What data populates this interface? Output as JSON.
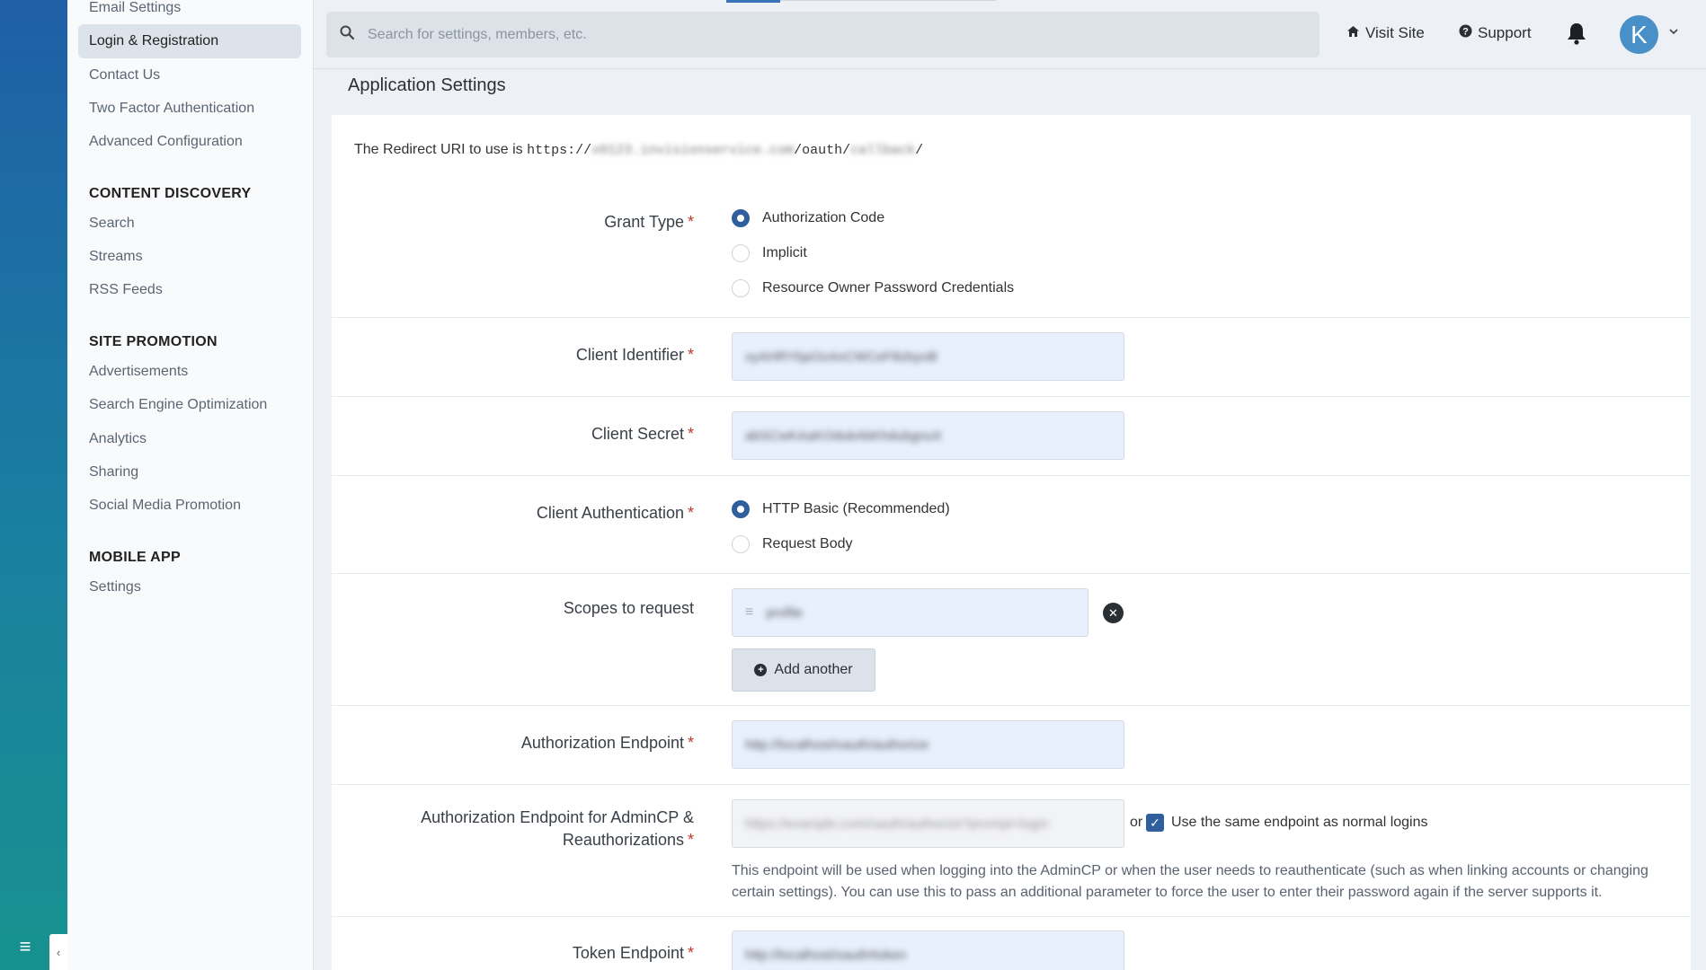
{
  "strip": {
    "menu_glyph": "≡",
    "collapse_glyph": "‹"
  },
  "sidebar": {
    "items": [
      {
        "label": "Email Settings"
      },
      {
        "label": "Login & Registration"
      },
      {
        "label": "Contact Us"
      },
      {
        "label": "Two Factor Authentication"
      },
      {
        "label": "Advanced Configuration"
      }
    ],
    "groups": [
      {
        "heading": "CONTENT DISCOVERY",
        "items": [
          "Search",
          "Streams",
          "RSS Feeds"
        ]
      },
      {
        "heading": "SITE PROMOTION",
        "items": [
          "Advertisements",
          "Search Engine Optimization",
          "Analytics",
          "Sharing",
          "Social Media Promotion"
        ]
      },
      {
        "heading": "MOBILE APP",
        "items": [
          "Settings"
        ]
      }
    ],
    "active_item": "Login & Registration"
  },
  "header": {
    "search_placeholder": "Search for settings, members, etc.",
    "visit_site": "Visit Site",
    "support": "Support",
    "avatar_letter": "K"
  },
  "page": {
    "section_title": "Application Settings",
    "redirect_prefix": "The Redirect URI to use is ",
    "redirect_scheme": "https://",
    "redirect_host": "x0123.invisionservice.com",
    "redirect_path": "/oauth/",
    "redirect_key": "callback",
    "redirect_end": "/",
    "grant_type": {
      "label": "Grant Type",
      "options": [
        "Authorization Code",
        "Implicit",
        "Resource Owner Password Credentials"
      ],
      "selected": 0
    },
    "client_identifier": {
      "label": "Client Identifier",
      "value": "xyAHRYbpOzAnCWCeF8zbyoB"
    },
    "client_secret": {
      "label": "Client Secret",
      "value": "abSCwKAaKOdukAbKhdubgnuX"
    },
    "client_auth": {
      "label": "Client Authentication",
      "options": [
        "HTTP Basic (Recommended)",
        "Request Body"
      ],
      "selected": 0
    },
    "scopes": {
      "label": "Scopes to request",
      "value": "profile",
      "add_label": "Add another"
    },
    "auth_endpoint": {
      "label": "Authorization Endpoint",
      "value": "http://localhost/oauth/authorize"
    },
    "auth_endpoint_admin": {
      "label_line1": "Authorization Endpoint for AdminCP &",
      "label_line2": "Reauthorizations",
      "value": "https://example.com/oauth/authorize?prompt=login",
      "or": "or",
      "checkbox_label": "Use the same endpoint as normal logins",
      "checked": true,
      "help": "This endpoint will be used when logging into the AdminCP or when the user needs to reauthenticate (such as when linking accounts or changing certain settings). You can use this to pass an additional parameter to force the user to enter their password again if the server supports it."
    },
    "token_endpoint": {
      "label": "Token Endpoint",
      "value": "http://localhost/oauth/token"
    }
  }
}
